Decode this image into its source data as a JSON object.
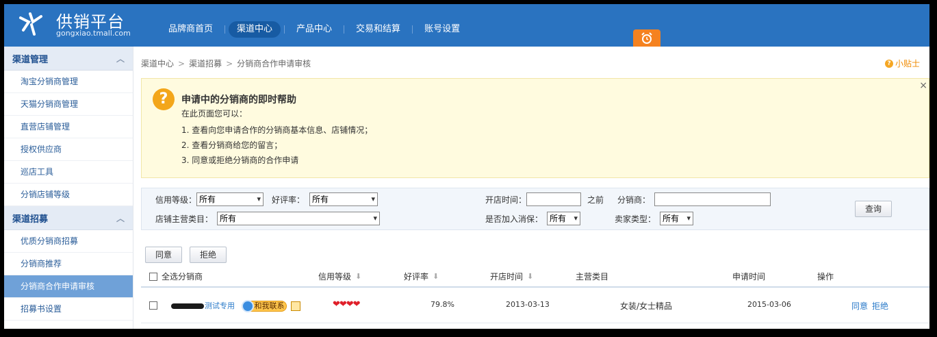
{
  "header": {
    "logo_title": "供销平台",
    "logo_sub": "gongxiao.tmall.com",
    "nav": [
      "品牌商首页",
      "渠道中心",
      "产品中心",
      "交易和结算",
      "账号设置"
    ],
    "active_nav_index": 1
  },
  "sidebar": {
    "groups": [
      {
        "title": "渠道管理",
        "items": [
          "淘宝分销商管理",
          "天猫分销商管理",
          "直营店铺管理",
          "授权供应商",
          "巡店工具",
          "分销店铺等级"
        ]
      },
      {
        "title": "渠道招募",
        "items": [
          "优质分销商招募",
          "分销商推荐",
          "分销商合作申请审核",
          "招募书设置"
        ]
      }
    ],
    "active_item": "分销商合作申请审核"
  },
  "breadcrumb": [
    "渠道中心",
    "渠道招募",
    "分销商合作申请审核"
  ],
  "tips_label": "小贴士",
  "help": {
    "title": "申请中的分销商的即时帮助",
    "intro": "在此页面您可以：",
    "items": [
      "1. 查看向您申请合作的分销商基本信息、店铺情况；",
      "2. 查看分销商给您的留言；",
      "3. 同意或拒绝分销商的合作申请"
    ]
  },
  "filter": {
    "credit_label": "信用等级：",
    "credit_value": "所有",
    "rating_label": "好评率：",
    "rating_value": "所有",
    "category_label": "店铺主营类目：",
    "category_value": "所有",
    "open_time_label": "开店时间：",
    "open_time_value": "",
    "before_label": "之前",
    "distributor_label": "分销商：",
    "distributor_value": "",
    "consumer_label": "是否加入消保：",
    "consumer_value": "所有",
    "seller_type_label": "卖家类型：",
    "seller_type_value": "所有",
    "query_label": "查询"
  },
  "actions": {
    "agree": "同意",
    "reject": "拒绝"
  },
  "table": {
    "headers": {
      "select_all": "全选分销商",
      "credit": "信用等级",
      "rating": "好评率",
      "open_time": "开店时间",
      "category": "主营类目",
      "apply_time": "申请时间",
      "operation": "操作"
    },
    "rows": [
      {
        "name": "测试专用",
        "contact": "和我联系",
        "credit_hearts": "❤❤❤❤",
        "rating": "79.8%",
        "open_time": "2013-03-13",
        "category": "女装/女士精品",
        "apply_time": "2015-03-06",
        "agree": "同意",
        "reject": "拒绝"
      }
    ]
  }
}
